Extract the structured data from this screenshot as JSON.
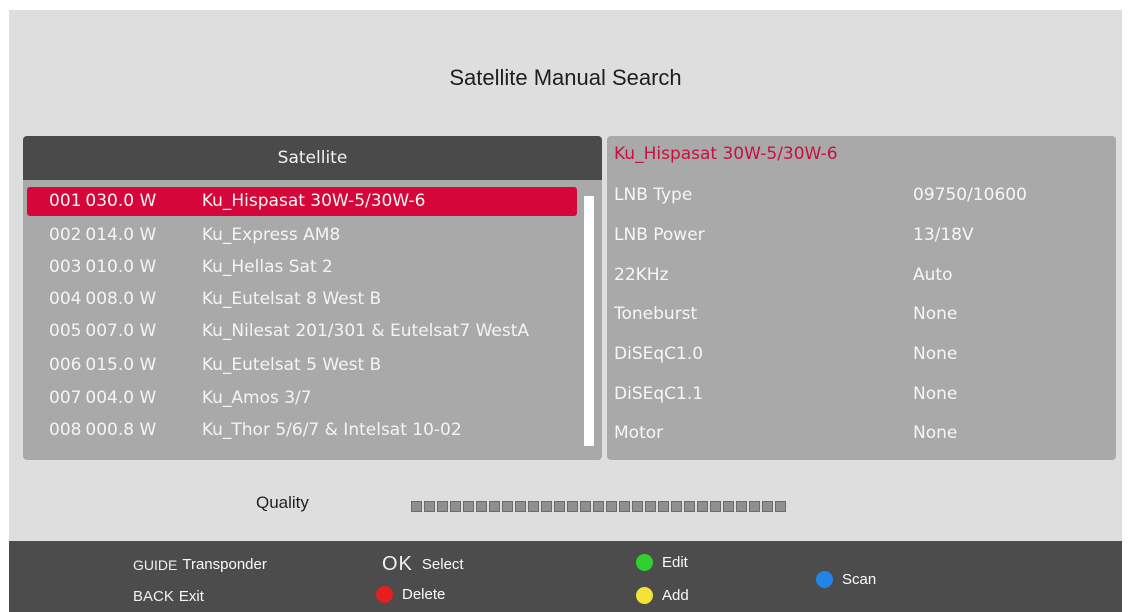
{
  "title": "Satellite Manual Search",
  "satellite_list": {
    "header": "Satellite",
    "selected_index": 0,
    "items": [
      {
        "num": "001",
        "position": "030.0  W",
        "name": "Ku_Hispasat 30W-5/30W-6"
      },
      {
        "num": "002",
        "position": "014.0  W",
        "name": "Ku_Express AM8"
      },
      {
        "num": "003",
        "position": "010.0  W",
        "name": "Ku_Hellas Sat 2"
      },
      {
        "num": "004",
        "position": "008.0  W",
        "name": "Ku_Eutelsat 8 West B"
      },
      {
        "num": "005",
        "position": "007.0  W",
        "name": "Ku_Nilesat 201/301 & Eutelsat7 WestA"
      },
      {
        "num": "006",
        "position": "015.0  W",
        "name": "Ku_Eutelsat 5 West B"
      },
      {
        "num": "007",
        "position": "004.0  W",
        "name": "Ku_Amos 3/7"
      },
      {
        "num": "008",
        "position": "000.8  W",
        "name": "Ku_Thor 5/6/7 & Intelsat 10-02"
      }
    ]
  },
  "params": {
    "satellite_name": "Ku_Hispasat 30W-5/30W-6",
    "rows": [
      {
        "label": "LNB Type",
        "value": "09750/10600"
      },
      {
        "label": "LNB Power",
        "value": "13/18V"
      },
      {
        "label": "22KHz",
        "value": "Auto"
      },
      {
        "label": "Toneburst",
        "value": "None"
      },
      {
        "label": "DiSEqC1.0",
        "value": "None"
      },
      {
        "label": "DiSEqC1.1",
        "value": "None"
      },
      {
        "label": "Motor",
        "value": "None"
      }
    ]
  },
  "quality": {
    "label": "Quality",
    "level": 0,
    "segments": 29
  },
  "help": {
    "guide_key": "GUIDE",
    "guide_action": "Transponder",
    "back_key": "BACK",
    "back_action": "Exit",
    "ok_key": "OK",
    "ok_action": "Select",
    "red_action": "Delete",
    "green_action": "Edit",
    "yellow_action": "Add",
    "blue_action": "Scan"
  },
  "colors": {
    "highlight": "#d4063a",
    "title_accent": "#c8103e",
    "green": "#2fd02f",
    "red": "#e61e1e",
    "yellow": "#f2e23a",
    "blue": "#2384e6"
  }
}
